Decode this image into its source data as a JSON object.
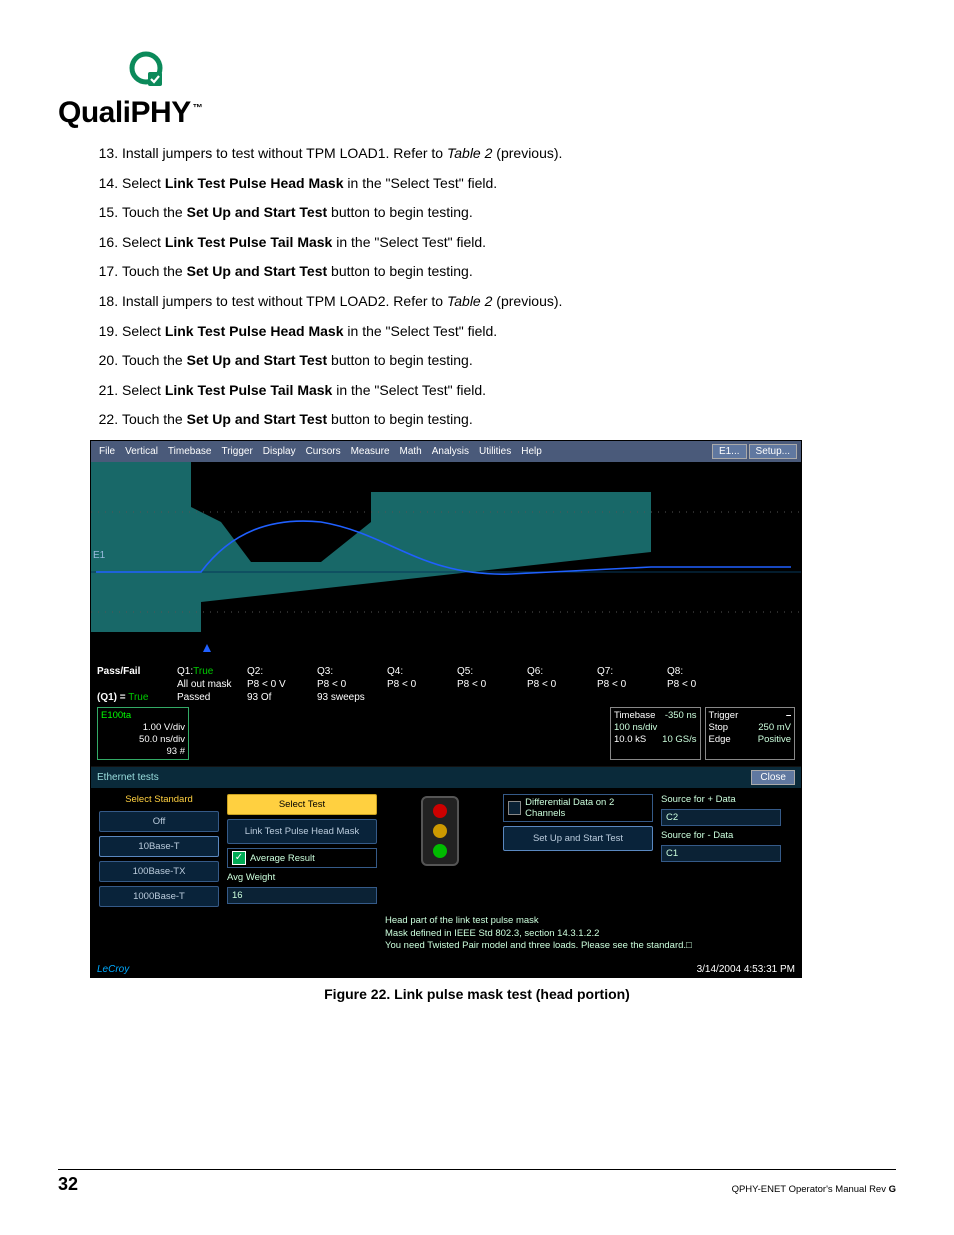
{
  "logo": {
    "word": "QualiPHY",
    "tm": "™"
  },
  "steps": [
    {
      "n": 13,
      "segments": [
        {
          "t": "Install jumpers to test without TPM LOAD1. Refer to "
        },
        {
          "t": "Table 2",
          "italic": true
        },
        {
          "t": " (previous)."
        }
      ]
    },
    {
      "n": 14,
      "segments": [
        {
          "t": "Select "
        },
        {
          "t": "Link Test Pulse Head Mask",
          "bold": true
        },
        {
          "t": " in the \"Select Test\" field."
        }
      ]
    },
    {
      "n": 15,
      "segments": [
        {
          "t": "Touch the "
        },
        {
          "t": "Set Up and Start Test",
          "bold": true
        },
        {
          "t": " button to begin testing."
        }
      ]
    },
    {
      "n": 16,
      "segments": [
        {
          "t": "Select "
        },
        {
          "t": "Link Test Pulse Tail Mask",
          "bold": true
        },
        {
          "t": " in the \"Select Test\" field."
        }
      ]
    },
    {
      "n": 17,
      "segments": [
        {
          "t": "Touch the "
        },
        {
          "t": "Set Up and Start Test",
          "bold": true
        },
        {
          "t": " button to begin testing."
        }
      ]
    },
    {
      "n": 18,
      "segments": [
        {
          "t": " Install jumpers to test without TPM LOAD2. Refer to "
        },
        {
          "t": "Table 2",
          "italic": true
        },
        {
          "t": " (previous)."
        }
      ]
    },
    {
      "n": 19,
      "segments": [
        {
          "t": "Select "
        },
        {
          "t": "Link Test Pulse Head Mask",
          "bold": true
        },
        {
          "t": " in the \"Select Test\" field."
        }
      ]
    },
    {
      "n": 20,
      "segments": [
        {
          "t": "Touch the "
        },
        {
          "t": "Set Up and Start Test",
          "bold": true
        },
        {
          "t": " button to begin testing."
        }
      ]
    },
    {
      "n": 21,
      "segments": [
        {
          "t": "Select "
        },
        {
          "t": "Link Test Pulse Tail Mask",
          "bold": true
        },
        {
          "t": " in the \"Select Test\" field."
        }
      ]
    },
    {
      "n": 22,
      "segments": [
        {
          "t": "Touch the "
        },
        {
          "t": "Set Up and Start Test",
          "bold": true
        },
        {
          "t": " button to begin testing."
        }
      ]
    }
  ],
  "scope": {
    "menubar": [
      "File",
      "Vertical",
      "Timebase",
      "Trigger",
      "Display",
      "Cursors",
      "Measure",
      "Math",
      "Analysis",
      "Utilities",
      "Help"
    ],
    "menu_right": {
      "label1": "E1...",
      "label2": "Setup..."
    },
    "ylabel": "E1",
    "passfail": {
      "title": "Pass/Fail",
      "q1": {
        "label": "Q1:",
        "state": "True",
        "sub": "All out mask"
      },
      "cols": [
        {
          "k": "Q2:",
          "v": "P8 < 0 V"
        },
        {
          "k": "Q3:",
          "v": "P8 < 0"
        },
        {
          "k": "Q4:",
          "v": "P8 < 0"
        },
        {
          "k": "Q5:",
          "v": "P8 < 0"
        },
        {
          "k": "Q6:",
          "v": "P8 < 0"
        },
        {
          "k": "Q7:",
          "v": "P8 < 0"
        },
        {
          "k": "Q8:",
          "v": "P8 < 0"
        }
      ],
      "q1line2": {
        "label": "(Q1) =",
        "state": "True",
        "passed": "Passed",
        "count": "93  Of",
        "sweeps": "93  sweeps"
      }
    },
    "channel": {
      "hdr": "E100ta",
      "l1": "1.00 V/div",
      "l2": "50.0 ns/div",
      "l3": "93 #"
    },
    "timebase": {
      "title": "Timebase",
      "v1": "-350 ns",
      "v2": "100 ns/div",
      "v3": "10.0 kS",
      "v4": "10 GS/s"
    },
    "trigger": {
      "title": "Trigger",
      "v1": "250 mV",
      "v2": "Stop",
      "v3": "Edge",
      "v4": "Positive"
    },
    "ethbar": {
      "title": "Ethernet tests",
      "close": "Close"
    },
    "panel": {
      "col_std": {
        "hdr": "Select Standard",
        "buttons": [
          "Off",
          "10Base-T",
          "100Base-TX",
          "1000Base-T"
        ]
      },
      "col_test": {
        "hdr": "Select Test",
        "selected": "Link Test Pulse Head Mask",
        "avg": "Average Result",
        "avgw_lbl": "Avg Weight",
        "avgw_val": "16"
      },
      "diff": {
        "lbl": "Differential Data on 2 Channels",
        "btn": "Set Up and Start Test"
      },
      "srcpos": {
        "lbl": "Source for + Data",
        "val": "C2"
      },
      "srcneg": {
        "lbl": "Source for - Data",
        "val": "C1"
      },
      "note_lines": [
        "Head part of the link test pulse mask",
        "Mask defined in IEEE Std 802.3, section 14.3.1.2.2",
        "You need Twisted Pair model and three loads.  Please see the standard.□"
      ]
    },
    "brand": "LeCroy",
    "datetime": "3/14/2004 4:53:31 PM"
  },
  "figure_caption": "Figure 22. Link pulse mask test (head portion)",
  "footer": {
    "page": "32",
    "doc_prefix": "QPHY-ENET Operator's Manual Rev ",
    "doc_rev": "G"
  }
}
